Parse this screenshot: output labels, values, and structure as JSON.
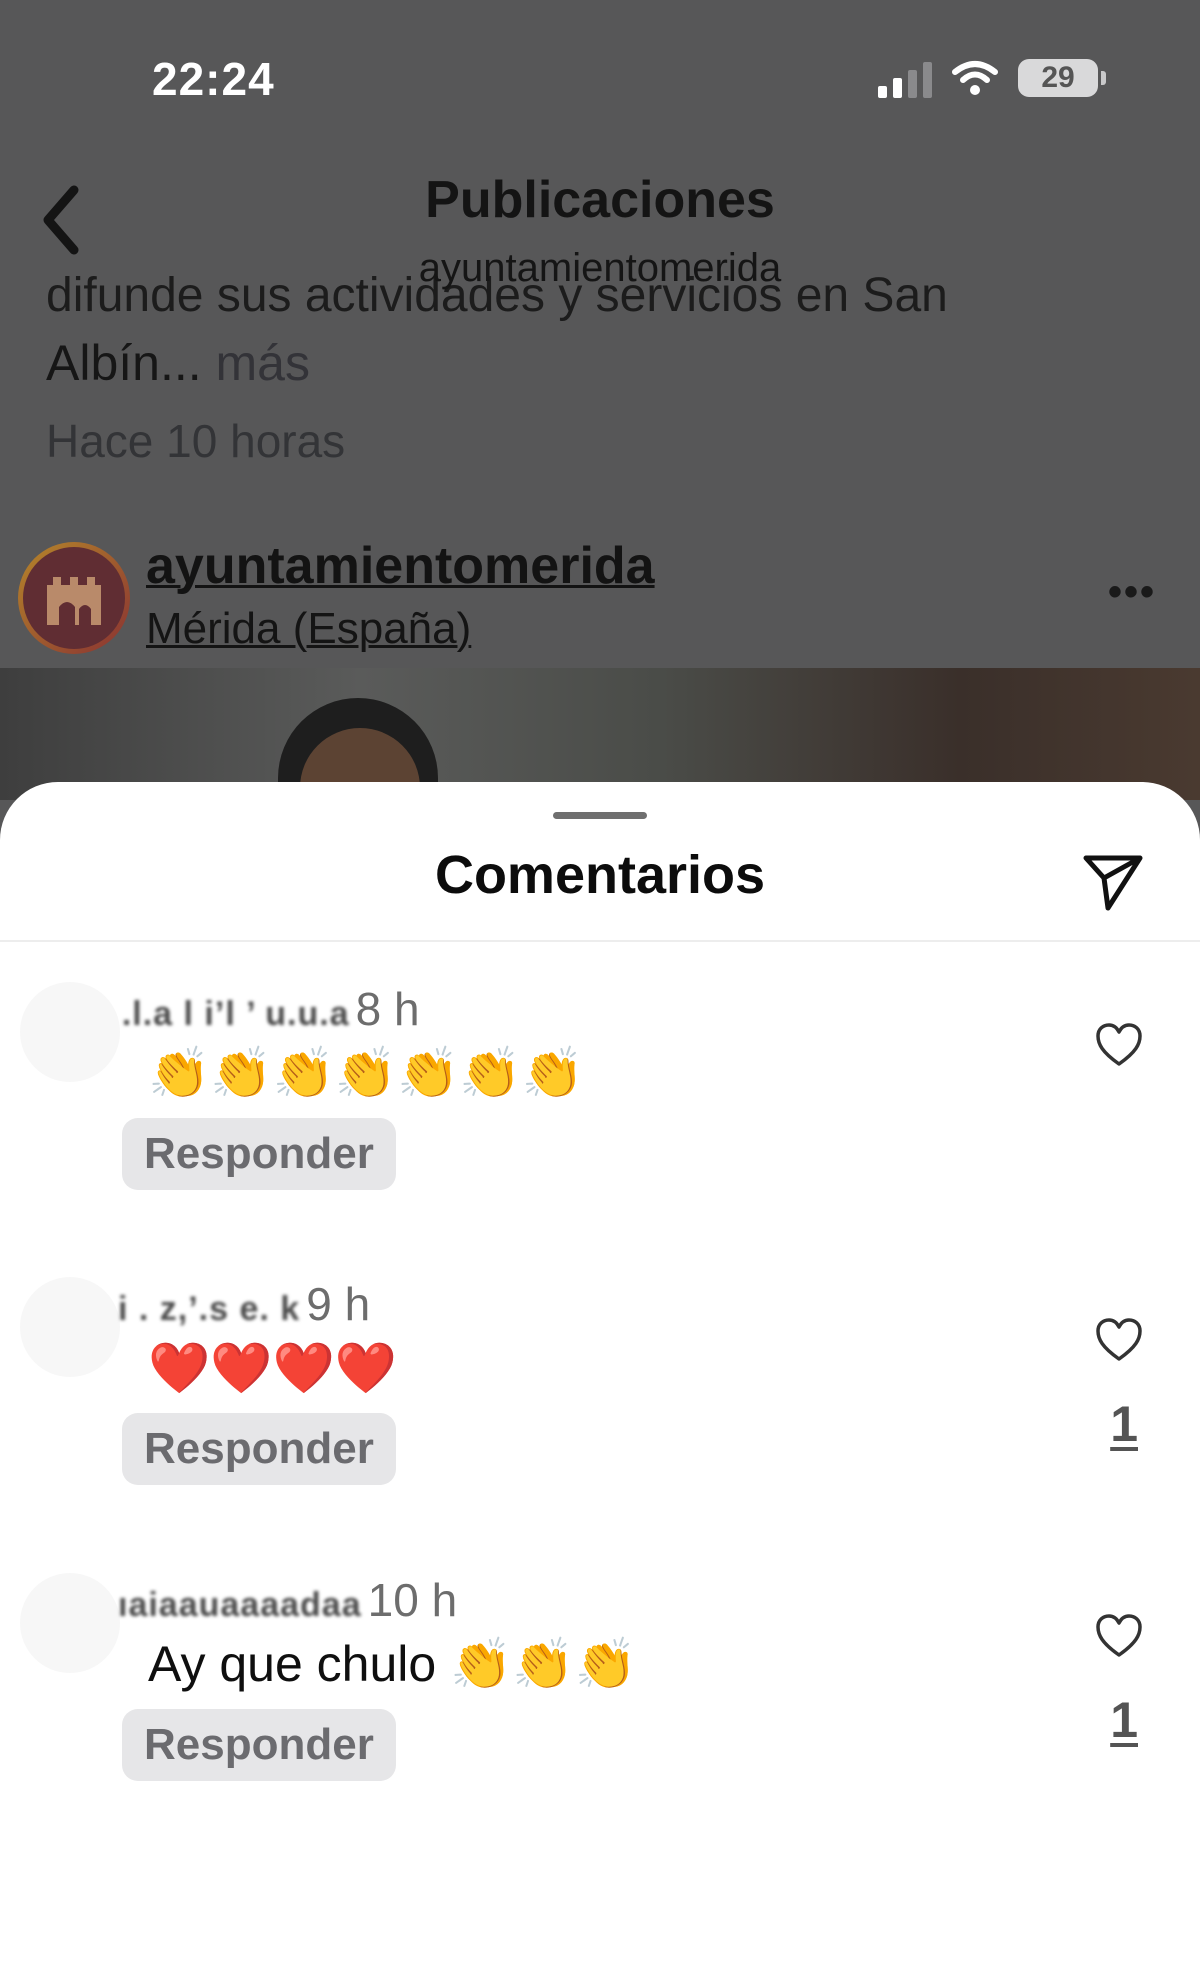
{
  "status_bar": {
    "time": "22:24",
    "battery": "29",
    "icons": [
      "signal-icon",
      "wifi-icon",
      "battery-icon"
    ]
  },
  "nav": {
    "title": "Publicaciones",
    "subtitle": "ayuntamientomerida",
    "back_icon": "chevron-left-icon"
  },
  "post": {
    "caption_clipped": "difunde sus actividades y servicios en San",
    "caption_end": "Albín...",
    "more_label": " más",
    "time": "Hace 10 horas",
    "author": "ayuntamientomerida",
    "location": "Mérida (España)",
    "options_icon": "more-horizontal-icon"
  },
  "comments_sheet": {
    "title": "Comentarios",
    "send_icon": "paper-plane-icon",
    "comments": [
      {
        "username": " .l.a l  i’l ’ u.u.a",
        "time": "8 h",
        "text": "👏👏👏👏👏👏👏",
        "reply_label": "Responder",
        "likes": ""
      },
      {
        "username": "i . z,’.s e. k",
        "time": "9 h",
        "text": "❤️❤️❤️❤️",
        "reply_label": "Responder",
        "likes": "1"
      },
      {
        "username": "ıaiaauaaaadaa",
        "time": "10 h",
        "text": "Ay que chulo 👏👏👏",
        "reply_label": "Responder",
        "likes": "1"
      }
    ]
  },
  "colors": {
    "overlay_background": "#575758",
    "sheet_background": "#ffffff",
    "reply_button_background": "#e6e6e8"
  }
}
